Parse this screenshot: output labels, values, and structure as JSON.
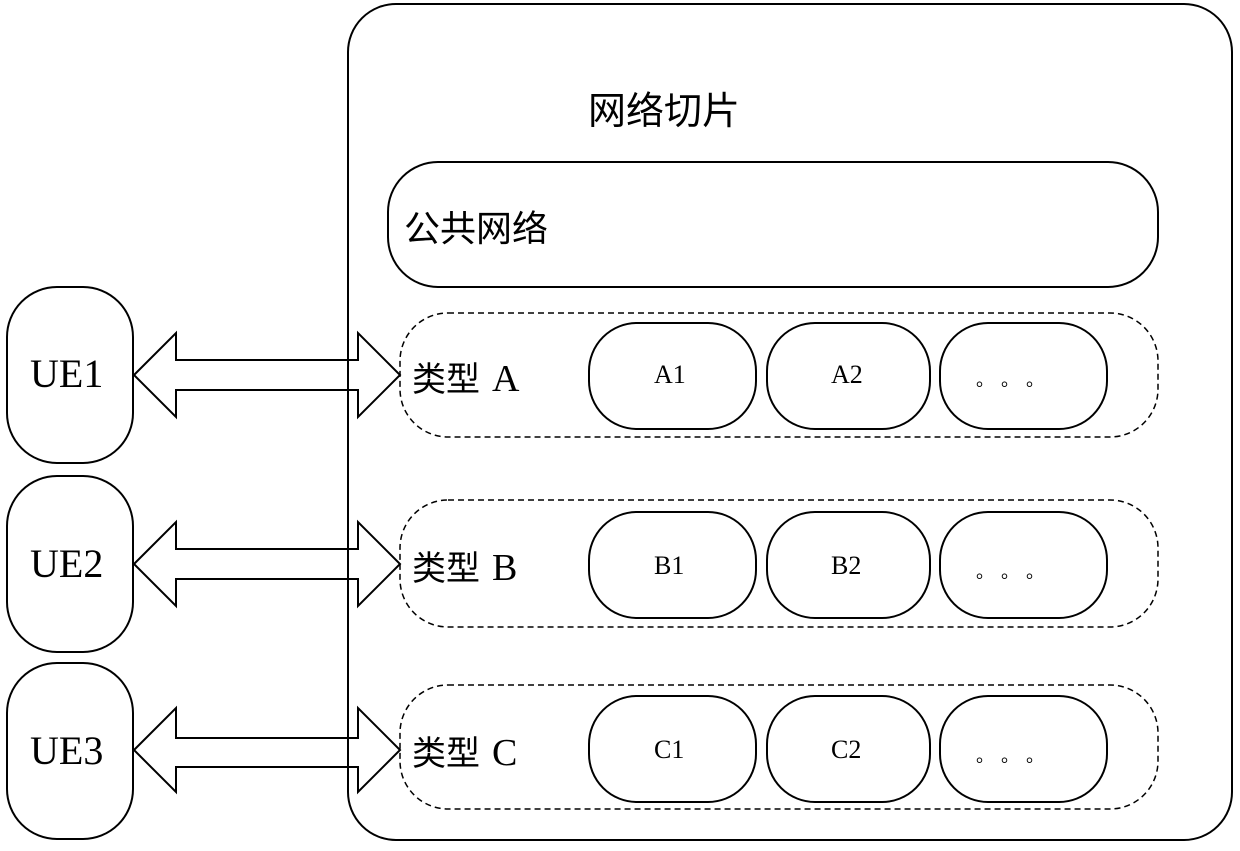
{
  "diagram": {
    "title": "网络切片",
    "common_network": "公共网络",
    "ues": [
      {
        "label": "UE1"
      },
      {
        "label": "UE2"
      },
      {
        "label": "UE3"
      }
    ],
    "slice_types": [
      {
        "label": "类型",
        "letter": "A",
        "instances": [
          "A1",
          "A2",
          "。。。"
        ]
      },
      {
        "label": "类型",
        "letter": "B",
        "instances": [
          "B1",
          "B2",
          "。。。"
        ]
      },
      {
        "label": "类型",
        "letter": "C",
        "instances": [
          "C1",
          "C2",
          "。。。"
        ]
      }
    ],
    "connections": [
      {
        "from": "UE1",
        "to": "类型 A",
        "direction": "bidirectional"
      },
      {
        "from": "UE2",
        "to": "类型 B",
        "direction": "bidirectional"
      },
      {
        "from": "UE3",
        "to": "类型 C",
        "direction": "bidirectional"
      }
    ]
  }
}
